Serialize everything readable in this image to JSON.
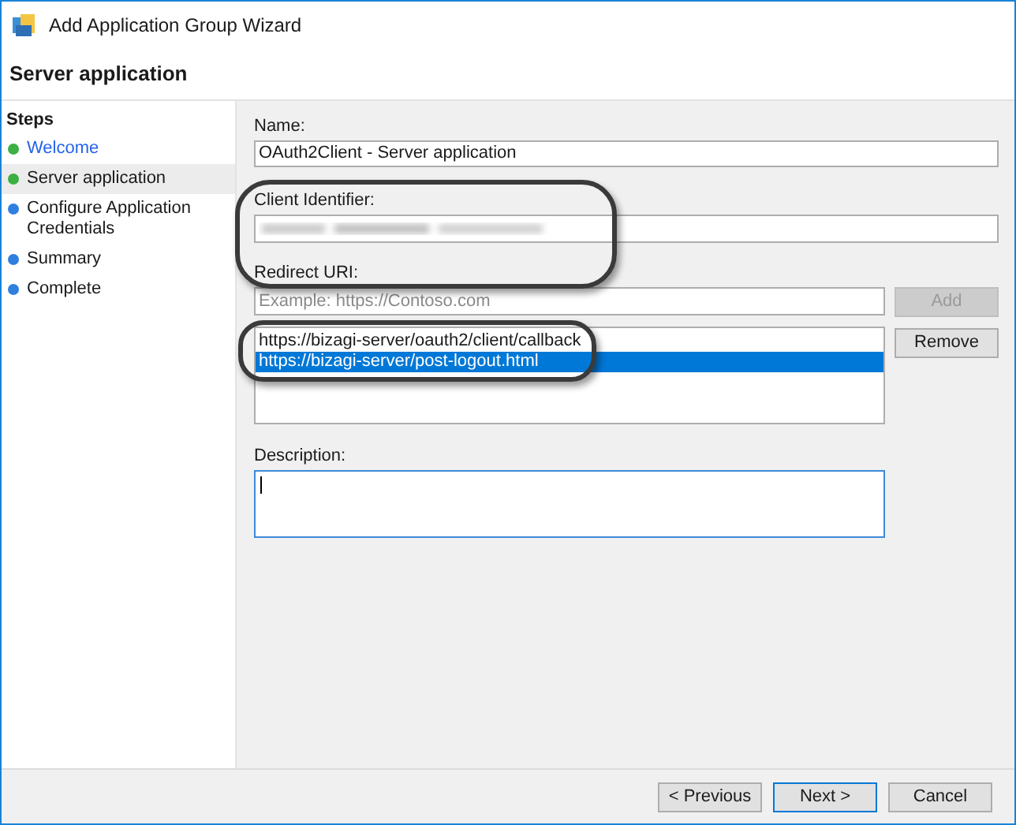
{
  "window": {
    "title": "Add Application Group Wizard"
  },
  "page_title": "Server application",
  "steps": {
    "heading": "Steps",
    "items": [
      {
        "label": "Welcome",
        "completed": true,
        "link": true,
        "selected": false
      },
      {
        "label": "Server application",
        "completed": true,
        "link": false,
        "selected": true
      },
      {
        "label": "Configure Application Credentials",
        "completed": false,
        "link": false,
        "selected": false
      },
      {
        "label": "Summary",
        "completed": false,
        "link": false,
        "selected": false
      },
      {
        "label": "Complete",
        "completed": false,
        "link": false,
        "selected": false
      }
    ]
  },
  "form": {
    "name": {
      "label": "Name:",
      "value": "OAuth2Client - Server application"
    },
    "client_identifier": {
      "label": "Client Identifier:"
    },
    "redirect_uri": {
      "label": "Redirect URI:",
      "placeholder": "Example: https://Contoso.com",
      "add_button": {
        "label": "Add",
        "disabled": true
      },
      "uris": [
        {
          "text": "https://bizagi-server/oauth2/client/callback",
          "selected": false
        },
        {
          "text": "https://bizagi-server/post-logout.html",
          "selected": true
        }
      ],
      "remove_button": {
        "label": "Remove",
        "disabled": false
      }
    },
    "description": {
      "label": "Description:"
    }
  },
  "buttons": [
    {
      "label": "< Previous",
      "default": false
    },
    {
      "label": "Next >",
      "default": true
    },
    {
      "label": "Cancel",
      "default": false
    }
  ]
}
